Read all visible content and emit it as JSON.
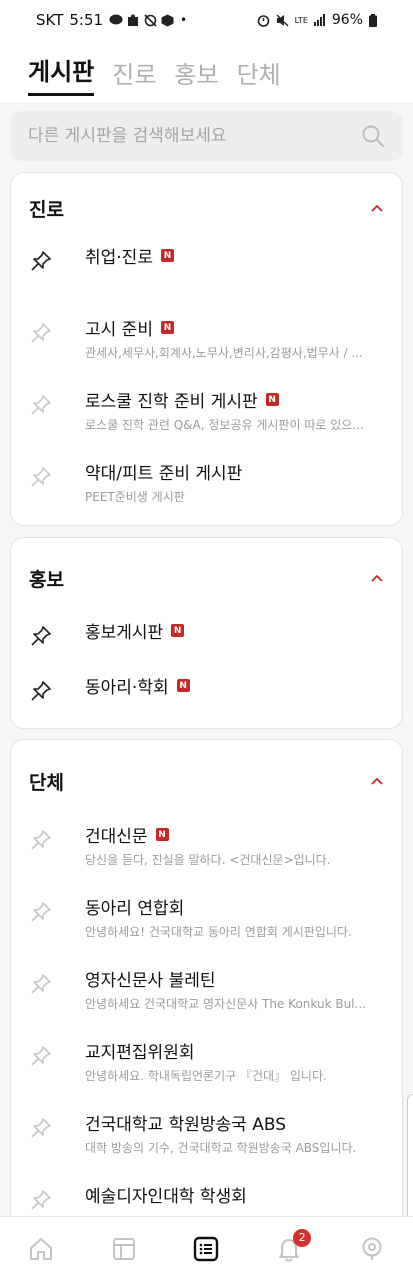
{
  "status": {
    "carrier": "SKT",
    "time": "5:51",
    "dot": "•",
    "network": "LTE",
    "battery": "96%"
  },
  "tabs": [
    "게시판",
    "진로",
    "홍보",
    "단체"
  ],
  "search": {
    "placeholder": "다른 게시판을 검색해보세요"
  },
  "sections": [
    {
      "title": "진로",
      "items": [
        {
          "name": "취업·진로",
          "badge": "N",
          "desc": "",
          "pinned": true
        },
        {
          "name": "고시 준비",
          "badge": "N",
          "desc": "관세사,세무사,회계사,노무사,변리사,감평사,법무사 / ...",
          "pinned": false
        },
        {
          "name": "로스쿨 진학 준비 게시판",
          "badge": "N",
          "desc": "로스쿨 진학 관련 Q&A, 정보공유 게시판이 따로 있으...",
          "pinned": false
        },
        {
          "name": "약대/피트 준비 게시판",
          "badge": "",
          "desc": "PEET준비생 게시판",
          "pinned": false
        }
      ]
    },
    {
      "title": "홍보",
      "items": [
        {
          "name": "홍보게시판",
          "badge": "N",
          "desc": "",
          "pinned": true
        },
        {
          "name": "동아리·학회",
          "badge": "N",
          "desc": "",
          "pinned": true
        }
      ]
    },
    {
      "title": "단체",
      "items": [
        {
          "name": "건대신문",
          "badge": "N",
          "desc": "당신을 듣다, 진실을 말하다. <건대신문>입니다.",
          "pinned": false
        },
        {
          "name": "동아리 연합회",
          "badge": "",
          "desc": "안녕하세요! 건국대학교 동아리 연합회 게시판입니다.",
          "pinned": false
        },
        {
          "name": "영자신문사 불레틴",
          "badge": "",
          "desc": "안녕하세요 건국대학교 영자신문사 The Konkuk Bul...",
          "pinned": false
        },
        {
          "name": "교지편집위원회",
          "badge": "",
          "desc": "안녕하세요. 학내독립언론기구 『건대』 입니다.",
          "pinned": false
        },
        {
          "name": "건국대학교 학원방송국 ABS",
          "badge": "",
          "desc": "대학 방송의 기수, 건국대학교 학원방송국 ABS입니다.",
          "pinned": false
        },
        {
          "name": "예술디자인대학 학생회",
          "badge": "",
          "desc": "",
          "pinned": false
        }
      ]
    }
  ],
  "nav": {
    "items": [
      "home-icon",
      "timetable-icon",
      "board-list-icon",
      "notification-icon",
      "campus-pick-icon"
    ],
    "active": 2,
    "notification_count": "2"
  },
  "colors": {
    "accent": "#c62828",
    "pinned": "#222222",
    "unpinned": "#c8c8c8"
  }
}
